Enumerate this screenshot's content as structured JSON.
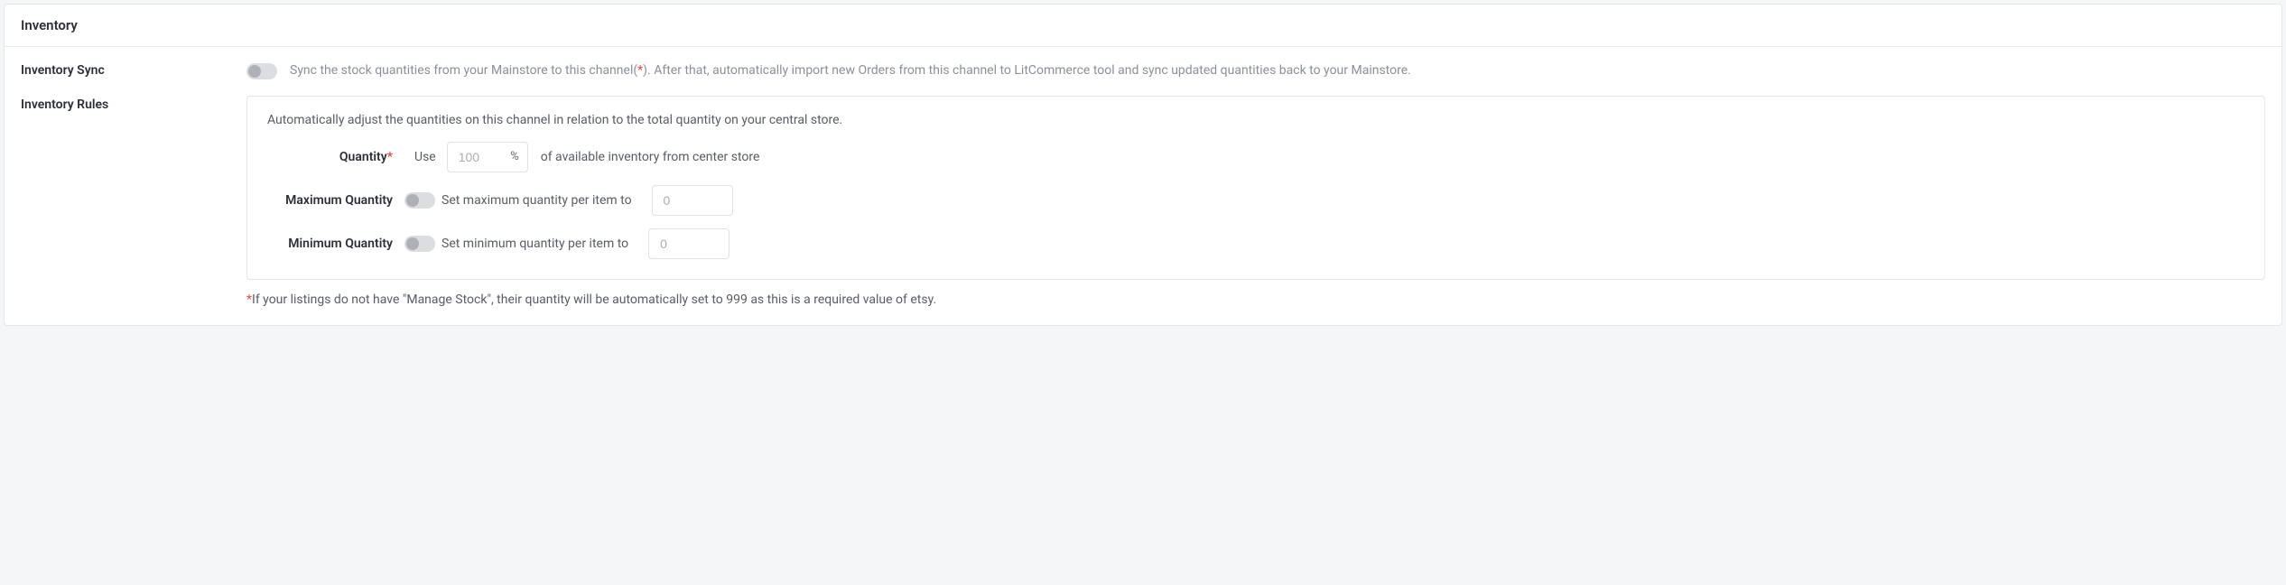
{
  "panel": {
    "title": "Inventory"
  },
  "inventory_sync": {
    "label": "Inventory Sync",
    "desc_part1": "Sync the stock quantities from your Mainstore to this channel(",
    "desc_asterisk": "*",
    "desc_part2": "). After that, automatically import new Orders from this channel to LitCommerce tool and sync updated quantities back to your Mainstore."
  },
  "inventory_rules": {
    "label": "Inventory Rules",
    "intro": "Automatically adjust the quantities on this channel in relation to the total quantity on your central store.",
    "quantity": {
      "label": "Quantity",
      "required": "*",
      "use_text": "Use",
      "placeholder": "100",
      "suffix": "%",
      "after_text": "of available inventory from center store"
    },
    "max": {
      "label": "Maximum Quantity",
      "text": "Set maximum quantity per item to",
      "placeholder": "0"
    },
    "min": {
      "label": "Minimum Quantity",
      "text": "Set minimum quantity per item to",
      "placeholder": "0"
    },
    "footnote_star": "*",
    "footnote": "If your listings do not have \"Manage Stock\", their quantity will be automatically set to 999 as this is a required value of etsy."
  }
}
